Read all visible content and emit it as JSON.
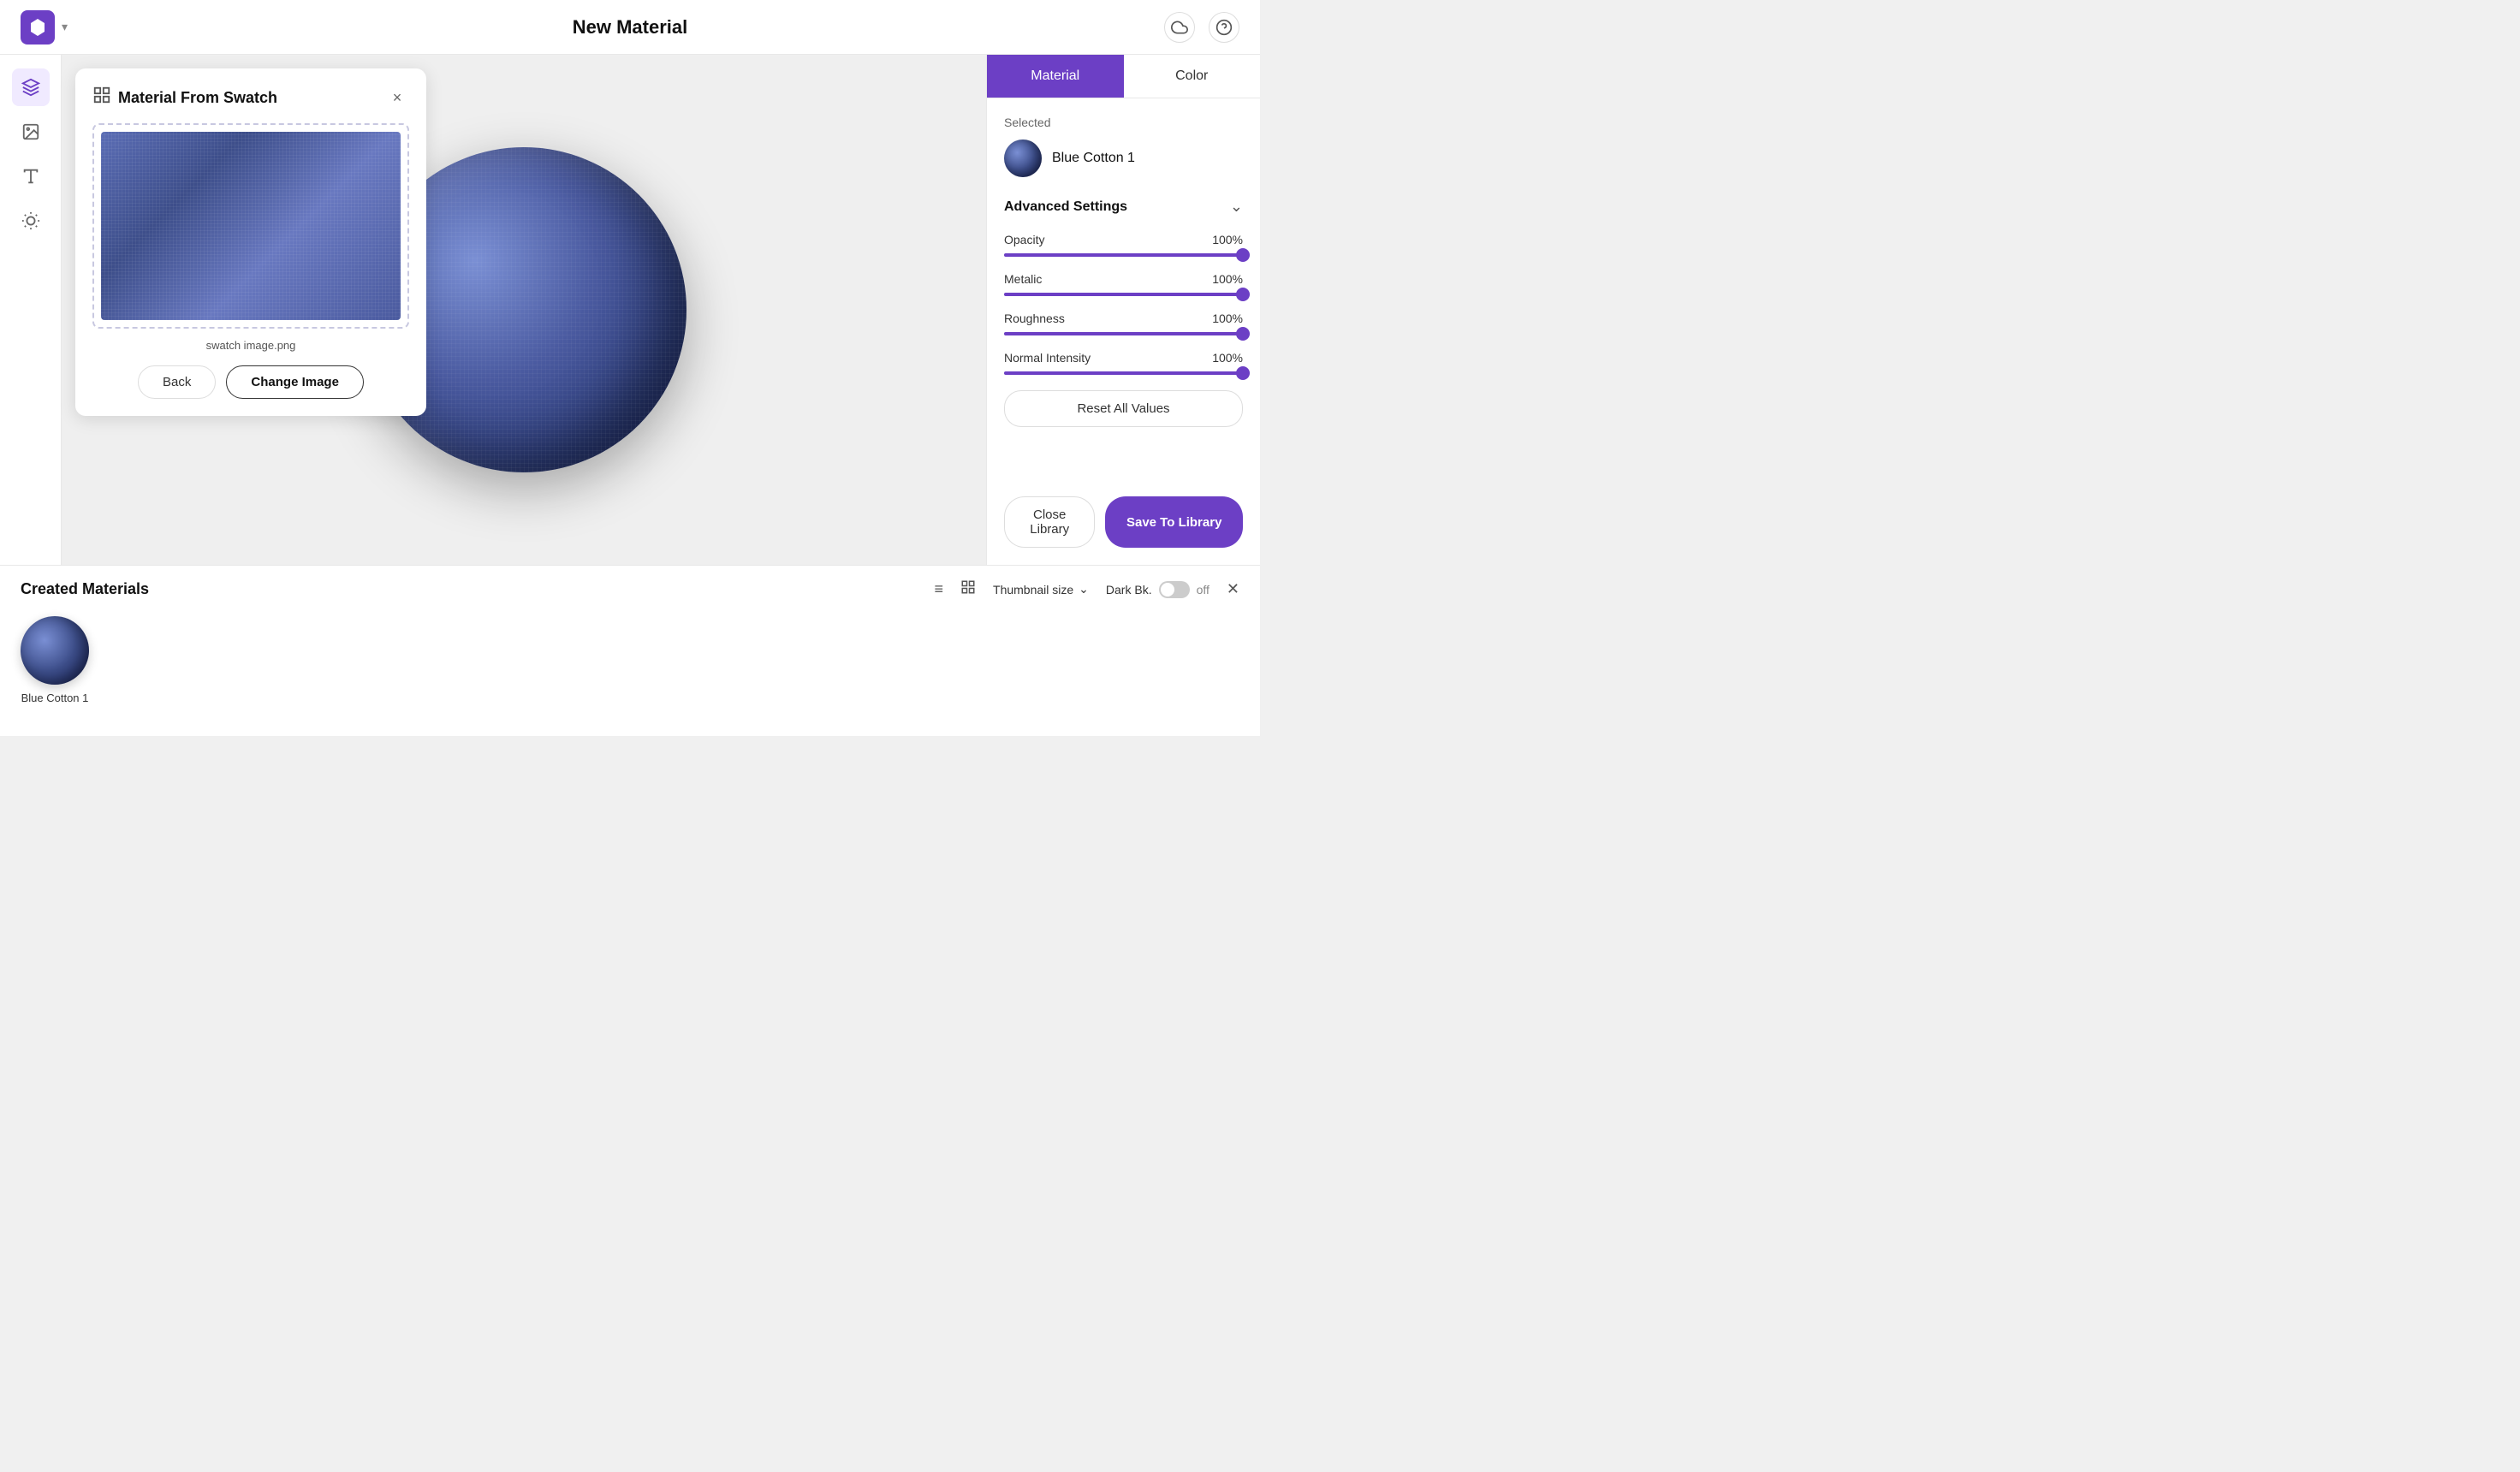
{
  "header": {
    "title": "New Material",
    "logo_alt": "logo"
  },
  "swatch_panel": {
    "title": "Material From Swatch",
    "filename": "swatch image.png",
    "back_label": "Back",
    "change_image_label": "Change Image"
  },
  "right_panel": {
    "tab_material": "Material",
    "tab_color": "Color",
    "selected_label": "Selected",
    "selected_material_name": "Blue Cotton 1",
    "advanced_settings_label": "Advanced Settings",
    "sliders": [
      {
        "label": "Opacity",
        "value": "100%",
        "percent": 100
      },
      {
        "label": "Metalic",
        "value": "100%",
        "percent": 100
      },
      {
        "label": "Roughness",
        "value": "100%",
        "percent": 100
      },
      {
        "label": "Normal Intensity",
        "value": "100%",
        "percent": 100
      }
    ],
    "reset_label": "Reset All Values",
    "close_library_label": "Close Library",
    "save_library_label": "Save To Library"
  },
  "bottom_panel": {
    "title": "Created Materials",
    "thumbnail_size_label": "Thumbnail size",
    "dark_bk_label": "Dark Bk.",
    "toggle_off_label": "off",
    "material_items": [
      {
        "name": "Blue Cotton 1"
      }
    ]
  },
  "sidebar": {
    "items": [
      {
        "icon": "layers",
        "label": "Layers",
        "active": true
      },
      {
        "icon": "image",
        "label": "Image",
        "active": false
      },
      {
        "icon": "text",
        "label": "Text",
        "active": false
      },
      {
        "icon": "sun",
        "label": "Lighting",
        "active": false
      }
    ]
  },
  "colors": {
    "primary": "#6c3fc5",
    "accent": "#6c3fc5"
  }
}
